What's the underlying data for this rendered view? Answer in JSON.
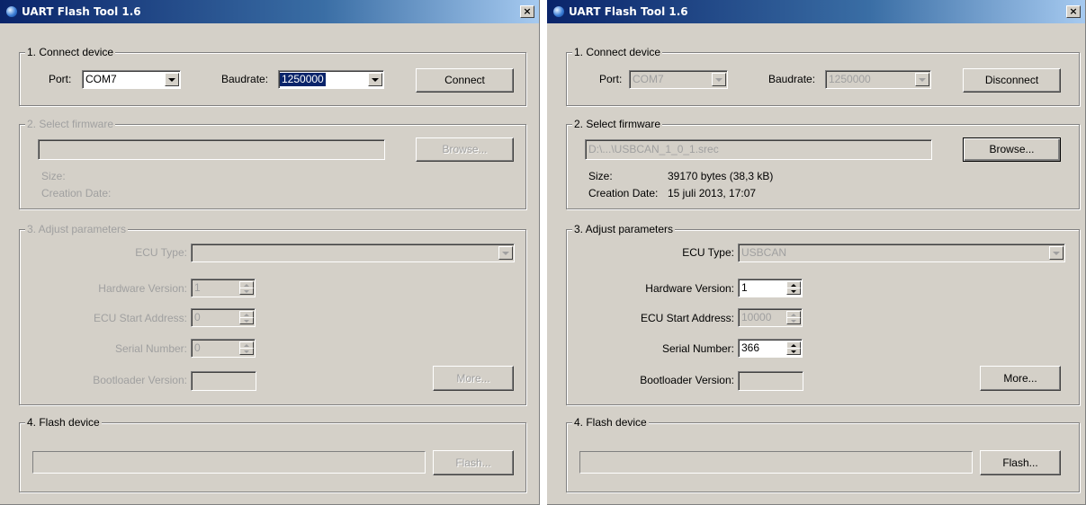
{
  "left": {
    "title": "UART Flash Tool 1.6",
    "close_glyph": "×",
    "connect": {
      "legend": "1. Connect device",
      "port_label": "Port:",
      "port_value": "COM7",
      "baud_label": "Baudrate:",
      "baud_value": "1250000",
      "button": "Connect"
    },
    "firmware": {
      "legend": "2. Select firmware",
      "path": "",
      "browse": "Browse...",
      "size_label": "Size:",
      "size_value": "",
      "date_label": "Creation Date:",
      "date_value": ""
    },
    "params": {
      "legend": "3. Adjust parameters",
      "ecu_type_label": "ECU Type:",
      "ecu_type_value": "",
      "hw_label": "Hardware Version:",
      "hw_value": "1",
      "start_label": "ECU Start Address:",
      "start_value": "0",
      "serial_label": "Serial Number:",
      "serial_value": "0",
      "boot_label": "Bootloader Version:",
      "boot_value": "",
      "more": "More..."
    },
    "flash": {
      "legend": "4. Flash device",
      "button": "Flash..."
    }
  },
  "right": {
    "title": "UART Flash Tool 1.6",
    "close_glyph": "×",
    "connect": {
      "legend": "1. Connect device",
      "port_label": "Port:",
      "port_value": "COM7",
      "baud_label": "Baudrate:",
      "baud_value": "1250000",
      "button": "Disconnect"
    },
    "firmware": {
      "legend": "2. Select firmware",
      "path": "D:\\...\\USBCAN_1_0_1.srec",
      "browse": "Browse...",
      "size_label": "Size:",
      "size_value": "39170 bytes (38,3 kB)",
      "date_label": "Creation Date:",
      "date_value": "15 juli 2013, 17:07"
    },
    "params": {
      "legend": "3. Adjust parameters",
      "ecu_type_label": "ECU Type:",
      "ecu_type_value": "USBCAN",
      "hw_label": "Hardware Version:",
      "hw_value": "1",
      "start_label": "ECU Start Address:",
      "start_value": "10000",
      "serial_label": "Serial Number:",
      "serial_value": "366",
      "boot_label": "Bootloader Version:",
      "boot_value": "",
      "more": "More..."
    },
    "flash": {
      "legend": "4. Flash device",
      "button": "Flash..."
    }
  },
  "colors": {
    "face": "#d4d0c8",
    "title_start": "#0a246a",
    "title_end": "#a6caf0",
    "selection": "#0a246a",
    "disabled_text": "#a0a0a0"
  }
}
